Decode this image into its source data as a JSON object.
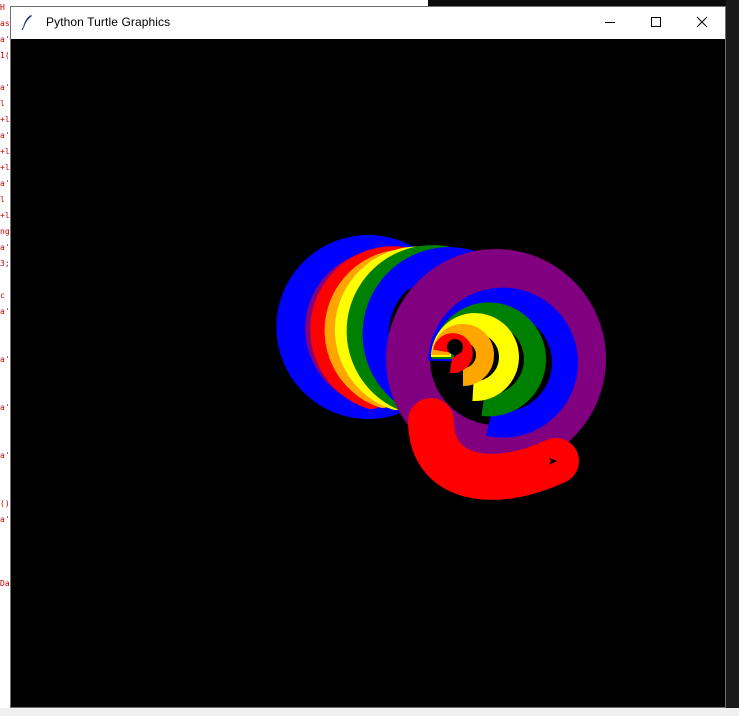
{
  "window": {
    "title": "Python Turtle Graphics"
  },
  "controls": {
    "minimize": "minimize-icon",
    "maximize": "maximize-icon",
    "close": "close-icon"
  },
  "canvas": {
    "background": "#000000",
    "rainbow_colors": [
      "#ff0000",
      "#ffa500",
      "#ffff00",
      "#008000",
      "#0000ff",
      "#800080"
    ]
  },
  "background_code_chars": [
    "H",
    "as",
    "a'",
    "1(",
    "",
    "a'",
    "l",
    "+l",
    "a'",
    "+l",
    "+l",
    "a'",
    "l",
    "+l",
    "ng",
    "a'",
    "3;",
    "",
    "c",
    "a'",
    "",
    "",
    "a'",
    "",
    "",
    "a'",
    "",
    "",
    "a'",
    "",
    "",
    "()",
    "a'",
    "",
    "",
    "",
    "Da"
  ]
}
